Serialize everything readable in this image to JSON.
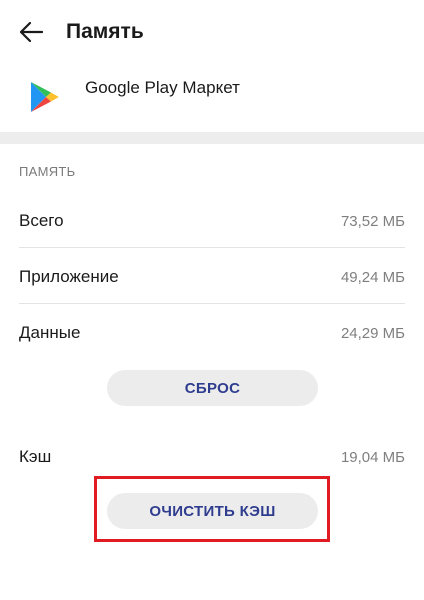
{
  "header": {
    "title": "Память",
    "back_icon": "arrow-left-icon"
  },
  "app": {
    "name": "Google Play Маркет",
    "icon": "google-play-icon"
  },
  "storage": {
    "section_title": "ПАМЯТЬ",
    "rows": [
      {
        "label": "Всего",
        "value": "73,52 МБ"
      },
      {
        "label": "Приложение",
        "value": "49,24 МБ"
      },
      {
        "label": "Данные",
        "value": "24,29 МБ"
      }
    ],
    "reset_label": "СБРОС",
    "cache": {
      "label": "Кэш",
      "value": "19,04 МБ"
    },
    "clear_cache_label": "ОЧИСТИТЬ КЭШ"
  },
  "colors": {
    "accent_text": "#2f3d8f",
    "highlight": "#e11b22",
    "divider_band": "#ededed"
  }
}
